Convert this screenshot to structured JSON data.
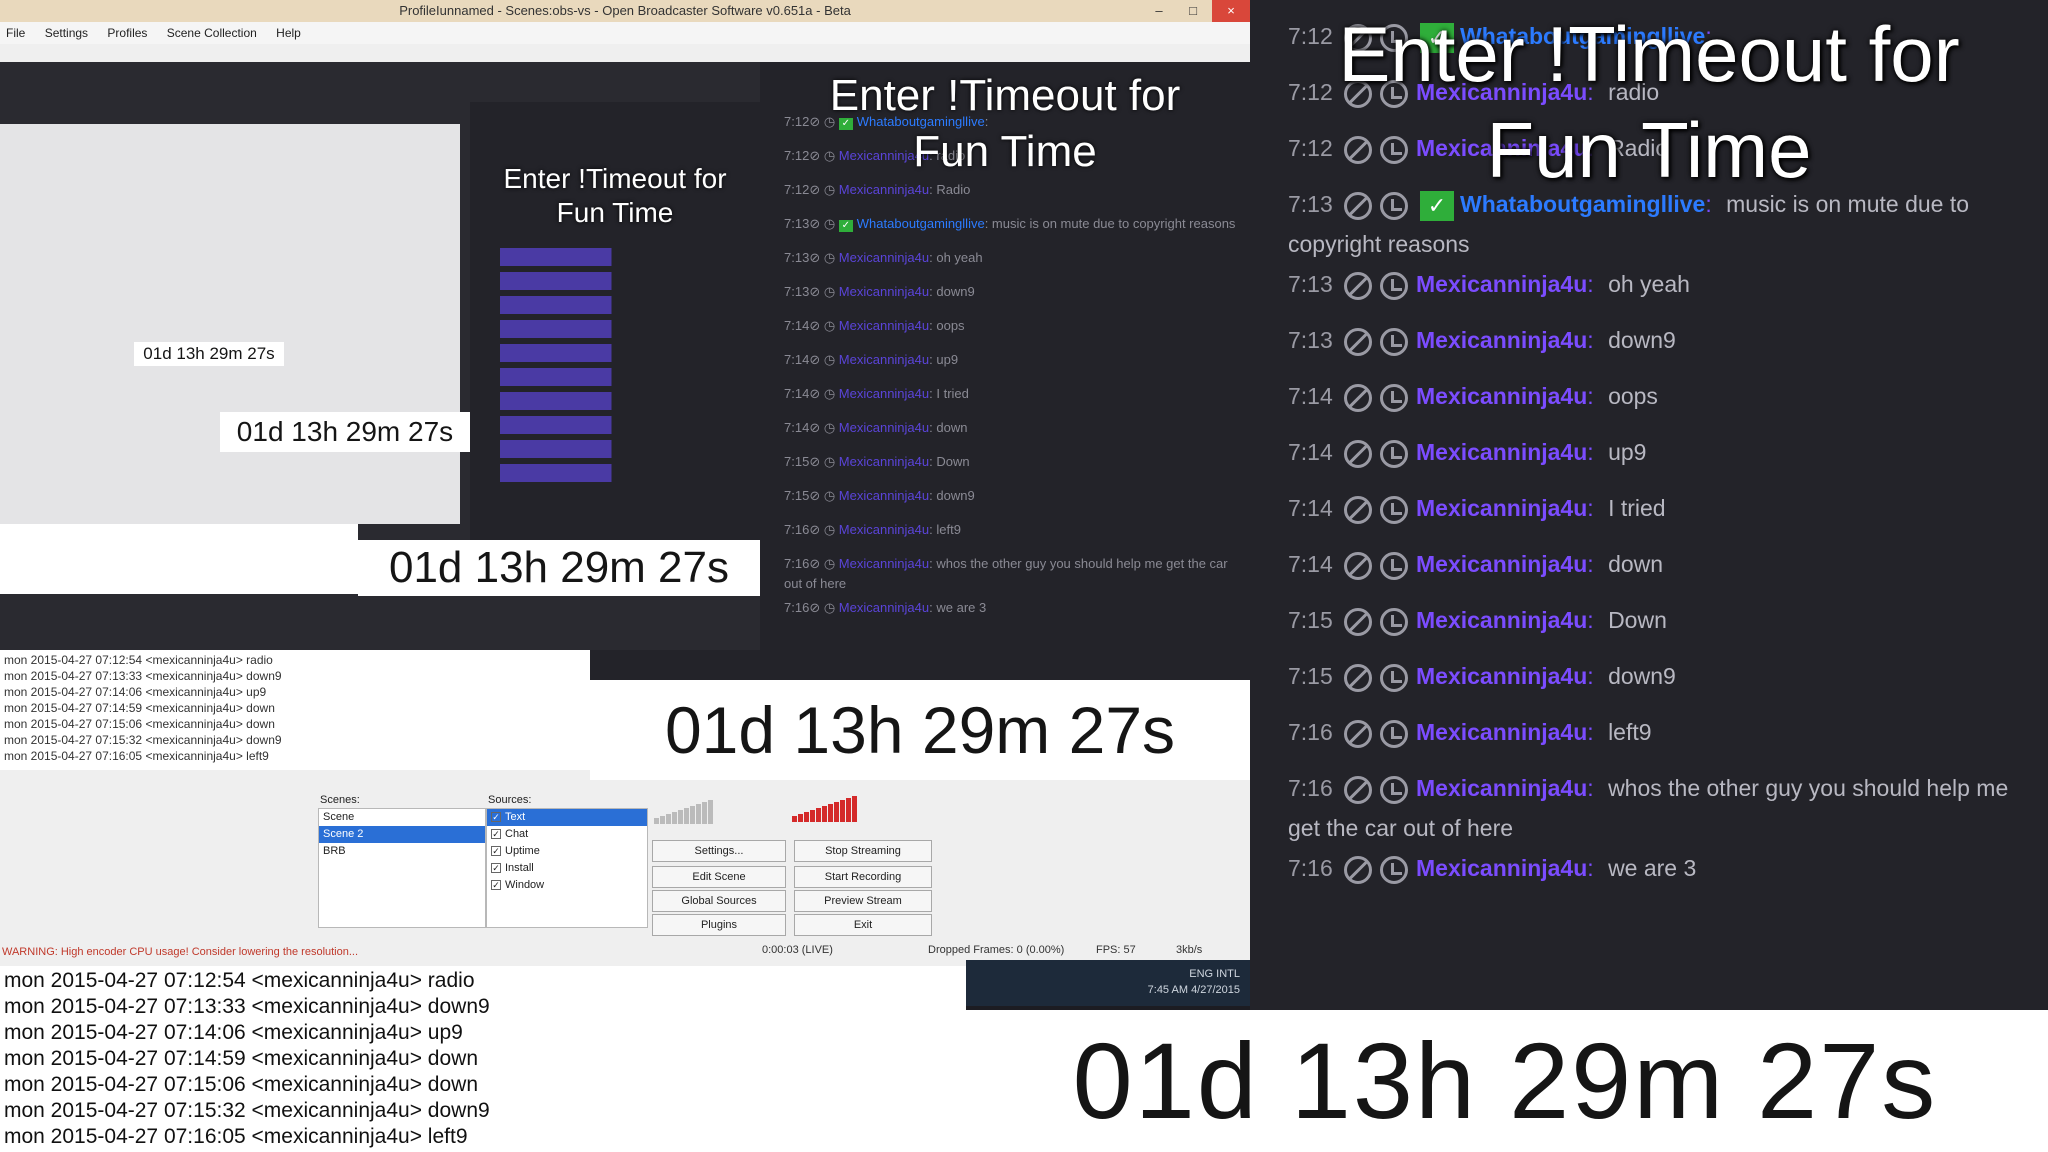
{
  "window": {
    "title": "ProfileIunnamed - Scenes:obs-vs - Open Broadcaster Software v0.651a - Beta",
    "minimize": "–",
    "maximize": "□",
    "close": "×"
  },
  "menu": [
    "File",
    "Settings",
    "Profiles",
    "Scene Collection",
    "Help"
  ],
  "overlay": {
    "line1": "Enter !Timeout for",
    "line2": "Fun Time",
    "countdown": "01d 13h 29m 27s"
  },
  "chat": [
    {
      "time": "7:12",
      "badge": true,
      "user": "Whataboutgamingllive",
      "blue": true,
      "msg": ""
    },
    {
      "time": "7:12",
      "badge": false,
      "user": "Mexicanninja4u",
      "blue": false,
      "msg": "radio"
    },
    {
      "time": "7:12",
      "badge": false,
      "user": "Mexicanninja4u",
      "blue": false,
      "msg": "Radio"
    },
    {
      "time": "7:13",
      "badge": true,
      "user": "Whataboutgamingllive",
      "blue": true,
      "msg": "music is on mute due to copyright reasons"
    },
    {
      "time": "7:13",
      "badge": false,
      "user": "Mexicanninja4u",
      "blue": false,
      "msg": "oh yeah"
    },
    {
      "time": "7:13",
      "badge": false,
      "user": "Mexicanninja4u",
      "blue": false,
      "msg": "down9"
    },
    {
      "time": "7:14",
      "badge": false,
      "user": "Mexicanninja4u",
      "blue": false,
      "msg": "oops"
    },
    {
      "time": "7:14",
      "badge": false,
      "user": "Mexicanninja4u",
      "blue": false,
      "msg": "up9"
    },
    {
      "time": "7:14",
      "badge": false,
      "user": "Mexicanninja4u",
      "blue": false,
      "msg": "I tried"
    },
    {
      "time": "7:14",
      "badge": false,
      "user": "Mexicanninja4u",
      "blue": false,
      "msg": "down"
    },
    {
      "time": "7:15",
      "badge": false,
      "user": "Mexicanninja4u",
      "blue": false,
      "msg": "Down"
    },
    {
      "time": "7:15",
      "badge": false,
      "user": "Mexicanninja4u",
      "blue": false,
      "msg": "down9"
    },
    {
      "time": "7:16",
      "badge": false,
      "user": "Mexicanninja4u",
      "blue": false,
      "msg": "left9"
    },
    {
      "time": "7:16",
      "badge": false,
      "user": "Mexicanninja4u",
      "blue": false,
      "msg": "whos the other guy you should help me get the car out of here"
    },
    {
      "time": "7:16",
      "badge": false,
      "user": "Mexicanninja4u",
      "blue": false,
      "msg": "we are 3"
    }
  ],
  "log": [
    "mon 2015-04-27 07:12:54 <mexicanninja4u> radio",
    "mon 2015-04-27 07:13:33 <mexicanninja4u> down9",
    "mon 2015-04-27 07:14:06 <mexicanninja4u> up9",
    "mon 2015-04-27 07:14:59 <mexicanninja4u> down",
    "mon 2015-04-27 07:15:06 <mexicanninja4u> down",
    "mon 2015-04-27 07:15:32 <mexicanninja4u> down9",
    "mon 2015-04-27 07:16:05 <mexicanninja4u> left9"
  ],
  "obs": {
    "scenes_label": "Scenes:",
    "scenes": [
      "Scene",
      "Scene 2",
      "BRB"
    ],
    "selected_scene": 1,
    "sources_label": "Sources:",
    "sources": [
      "Text",
      "Chat",
      "Uptime",
      "Install",
      "Window"
    ],
    "buttons": {
      "settings": "Settings...",
      "stop_streaming": "Stop Streaming",
      "edit_scene": "Edit Scene",
      "start_recording": "Start Recording",
      "global_sources": "Global Sources",
      "plugins": "Plugins",
      "exit": "Exit",
      "preview": "Preview Stream"
    },
    "status_warning": "WARNING: High encoder CPU usage! Consider lowering the resolution...",
    "status_time": "0:00:03 (LIVE)",
    "dropped_frames": "Dropped Frames: 0 (0.00%)",
    "fps": "FPS: 57",
    "bitrate": "3kb/s"
  },
  "taskbar": {
    "lang": "ENG",
    "region": "INTL",
    "time": "7:45 AM",
    "date": "4/27/2015"
  },
  "colors": {
    "chat_bg": "#232329",
    "user_purple": "#7b4cff",
    "user_blue": "#2c7bff",
    "badge_green": "#2fae3a"
  }
}
